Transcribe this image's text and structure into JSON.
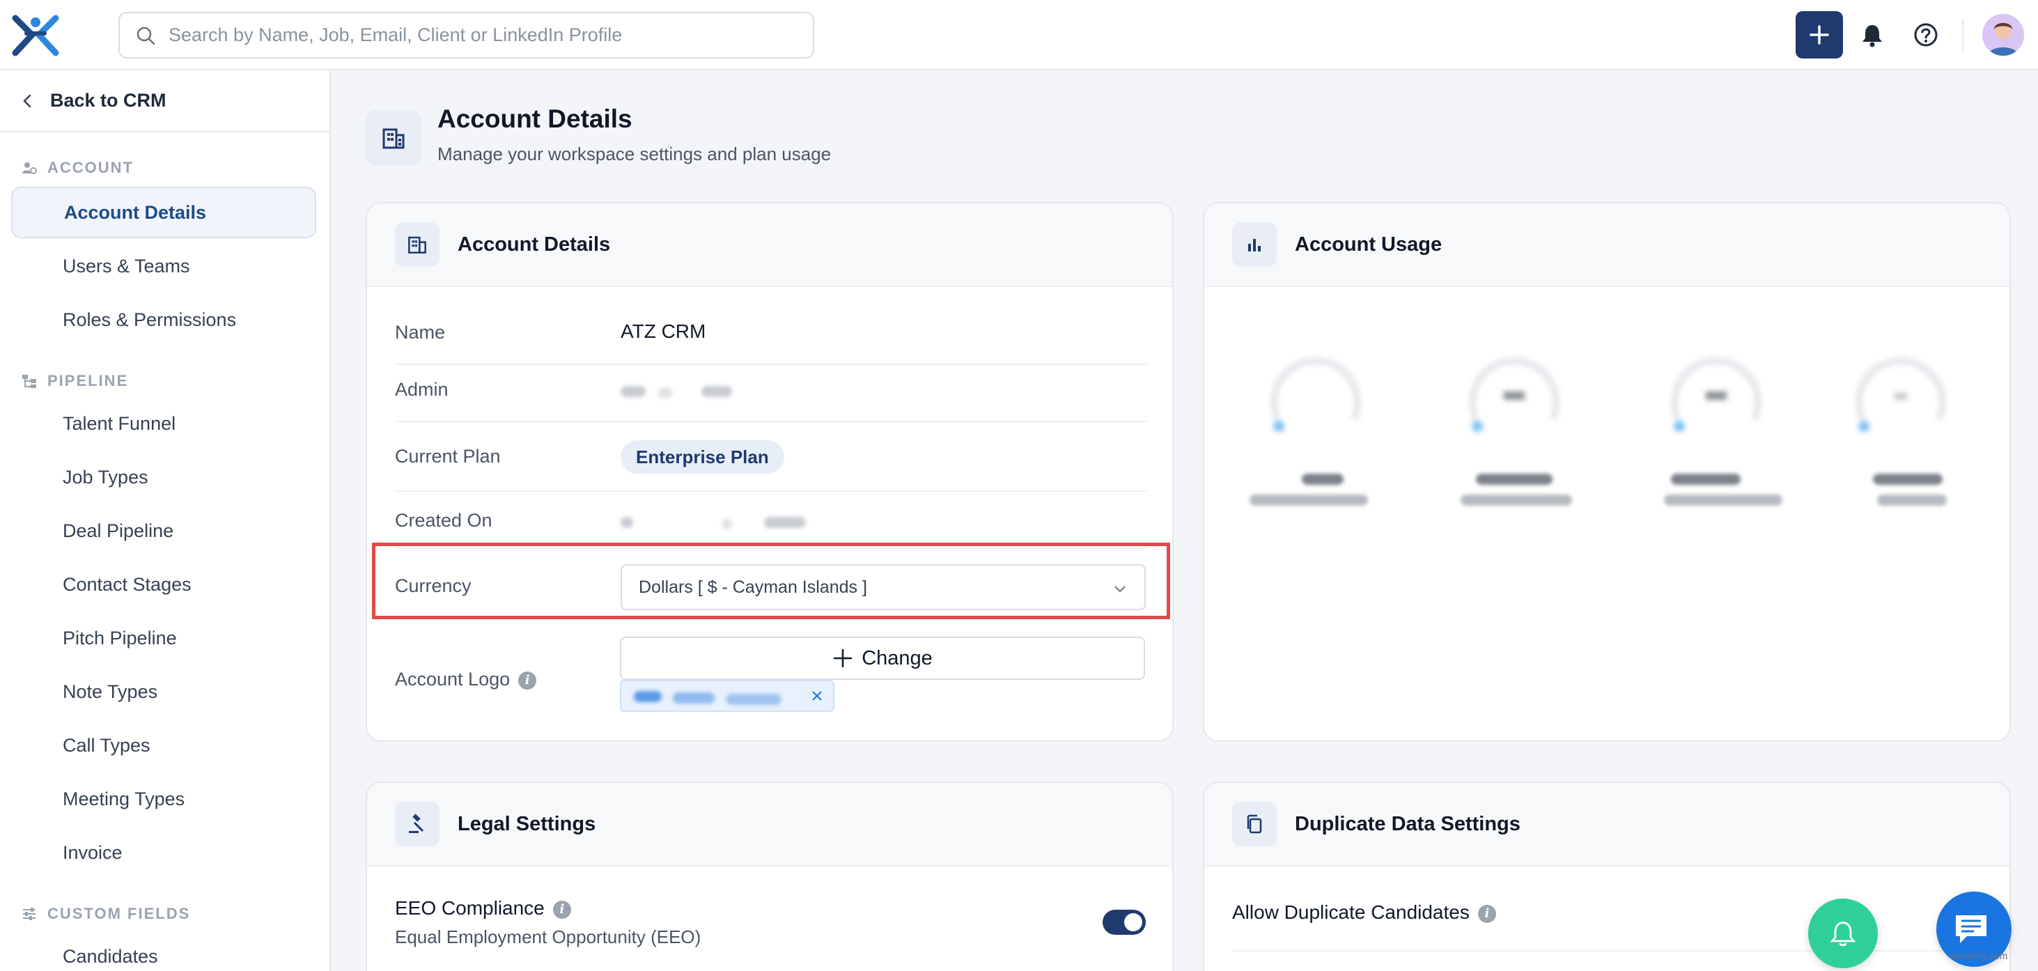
{
  "topbar": {
    "search_placeholder": "Search by Name, Job, Email, Client or LinkedIn Profile"
  },
  "sidebar": {
    "back_label": "Back to CRM",
    "sections": {
      "account": "ACCOUNT",
      "pipeline": "PIPELINE",
      "custom_fields": "CUSTOM FIELDS"
    },
    "items": [
      {
        "label": "Account Details",
        "active": true
      },
      {
        "label": "Users & Teams"
      },
      {
        "label": "Roles & Permissions"
      },
      {
        "label": "Talent Funnel"
      },
      {
        "label": "Job Types"
      },
      {
        "label": "Deal Pipeline"
      },
      {
        "label": "Contact Stages"
      },
      {
        "label": "Pitch Pipeline"
      },
      {
        "label": "Note Types"
      },
      {
        "label": "Call Types"
      },
      {
        "label": "Meeting Types"
      },
      {
        "label": "Invoice"
      },
      {
        "label": "Candidates"
      }
    ]
  },
  "page": {
    "title": "Account Details",
    "subtitle": "Manage your workspace settings and plan usage"
  },
  "account_card": {
    "title": "Account Details",
    "name_label": "Name",
    "name_value": "ATZ CRM",
    "admin_label": "Admin",
    "plan_label": "Current Plan",
    "plan_value": "Enterprise Plan",
    "created_label": "Created On",
    "currency_label": "Currency",
    "currency_value": "Dollars [ $ - Cayman Islands ]",
    "logo_label": "Account Logo",
    "change_label": "Change"
  },
  "usage_card": {
    "title": "Account Usage"
  },
  "legal_card": {
    "title": "Legal Settings",
    "eeo_label": "EEO Compliance",
    "eeo_sub": "Equal Employment Opportunity (EEO)",
    "eeo_enabled": true
  },
  "duplicate_card": {
    "title": "Duplicate Data Settings",
    "allow_label": "Allow Duplicate Candidates"
  },
  "watermark": "annotely.com",
  "colors": {
    "brand_navy": "#1e3a6e",
    "highlight_red": "#e14b4b",
    "fab_green": "#2fcf9a",
    "fab_blue": "#1a75e0"
  }
}
